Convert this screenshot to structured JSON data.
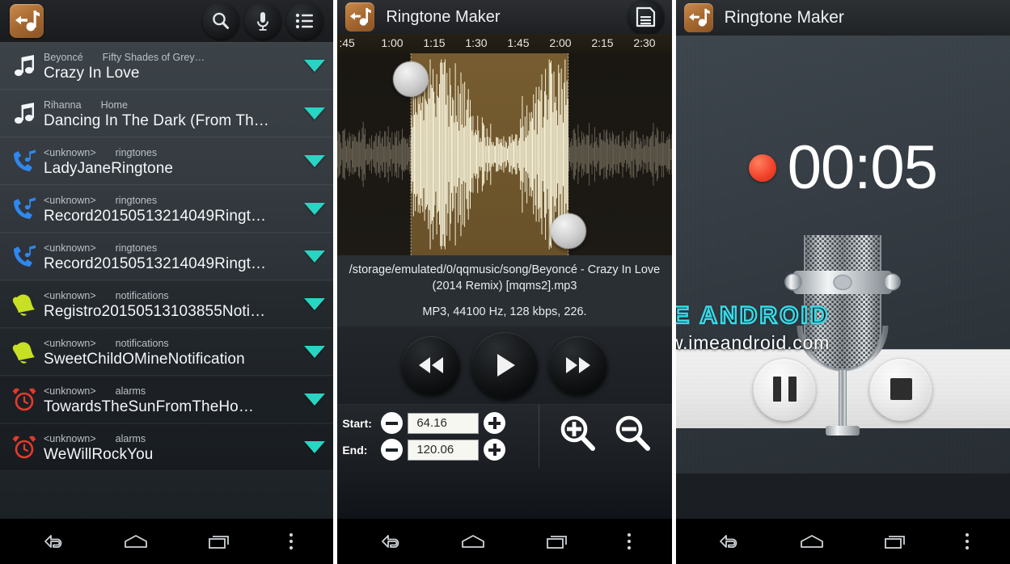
{
  "panel1": {
    "header": {
      "app_icon": "music-note-back-icon",
      "actions": [
        {
          "name": "search-icon",
          "label": "Search"
        },
        {
          "name": "microphone-icon",
          "label": "Record"
        },
        {
          "name": "list-icon",
          "label": "List"
        }
      ]
    },
    "list_items": [
      {
        "icon": "music-note-icon",
        "artist": "Beyoncé",
        "album": "Fifty Shades of Grey…",
        "title": "Crazy In Love"
      },
      {
        "icon": "music-note-icon",
        "artist": "Rihanna",
        "album": "Home",
        "title": "Dancing In The Dark (From Th…"
      },
      {
        "icon": "phone-ringtone-icon",
        "artist": "<unknown>",
        "album": "ringtones",
        "title": "LadyJaneRingtone"
      },
      {
        "icon": "phone-ringtone-icon",
        "artist": "<unknown>",
        "album": "ringtones",
        "title": "Record20150513214049Ringt…"
      },
      {
        "icon": "phone-ringtone-icon",
        "artist": "<unknown>",
        "album": "ringtones",
        "title": "Record20150513214049Ringt…"
      },
      {
        "icon": "bell-notification-icon",
        "artist": "<unknown>",
        "album": "notifications",
        "title": "Registro20150513103855Noti…"
      },
      {
        "icon": "bell-notification-icon",
        "artist": "<unknown>",
        "album": "notifications",
        "title": "SweetChildOMineNotification"
      },
      {
        "icon": "alarm-clock-icon",
        "artist": "<unknown>",
        "album": "alarms",
        "title": "TowardsTheSunFromTheHo…"
      },
      {
        "icon": "alarm-clock-icon",
        "artist": "<unknown>",
        "album": "alarms",
        "title": "WeWillRockYou"
      }
    ],
    "caret_color": "#2ad3c2"
  },
  "panel2": {
    "title": "Ringtone Maker",
    "app_icon": "music-note-back-icon",
    "save_icon": "save-floppy-icon",
    "ruler_ticks": [
      ":45",
      "1:00",
      "1:15",
      "1:30",
      "1:45",
      "2:00",
      "2:15",
      "2:30"
    ],
    "file_path": "/storage/emulated/0/qqmusic/song/Beyoncé - Crazy In Love (2014 Remix) [mqms2].mp3",
    "file_info": "MP3, 44100 Hz, 128 kbps, 226.",
    "transport": [
      {
        "name": "rewind-button",
        "label": "Rewind"
      },
      {
        "name": "play-button",
        "label": "Play"
      },
      {
        "name": "fast-forward-button",
        "label": "Fast forward"
      }
    ],
    "start_label": "Start:",
    "start_value": "64.16",
    "end_label": "End:",
    "end_value": "120.06",
    "zoom_in_icon": "zoom-in-icon",
    "zoom_out_icon": "zoom-out-icon",
    "selection_start_pct": 22,
    "selection_end_pct": 69
  },
  "panel3": {
    "title": "Ringtone Maker",
    "app_icon": "music-note-back-icon",
    "timer": "00:05",
    "recording_indicator": "record-dot-icon",
    "mic_icon": "studio-microphone-icon",
    "controls": [
      {
        "name": "pause-button",
        "label": "Pause"
      },
      {
        "name": "stop-button",
        "label": "Stop"
      }
    ]
  },
  "watermark": {
    "line1": "IME ANDROID",
    "line2": "www.imeandroid.com",
    "accent": "#37d9e8"
  },
  "navbar": {
    "back": "back-nav-icon",
    "home": "home-nav-icon",
    "recents": "recents-nav-icon",
    "menu": "overflow-menu-icon"
  }
}
